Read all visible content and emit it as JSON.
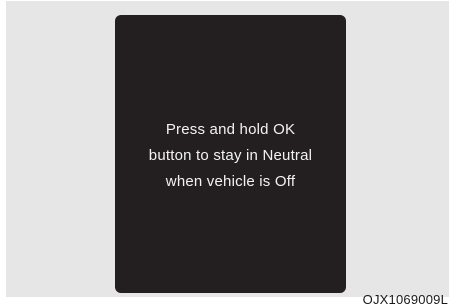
{
  "display": {
    "message_lines": [
      "Press and hold OK",
      "button to stay in Neutral",
      "when vehicle is Off"
    ]
  },
  "figure": {
    "code": "OJX1069009L"
  },
  "colors": {
    "panel_background": "#e6e6e6",
    "screen_background": "#231f20",
    "screen_text": "#f2f2f2"
  }
}
